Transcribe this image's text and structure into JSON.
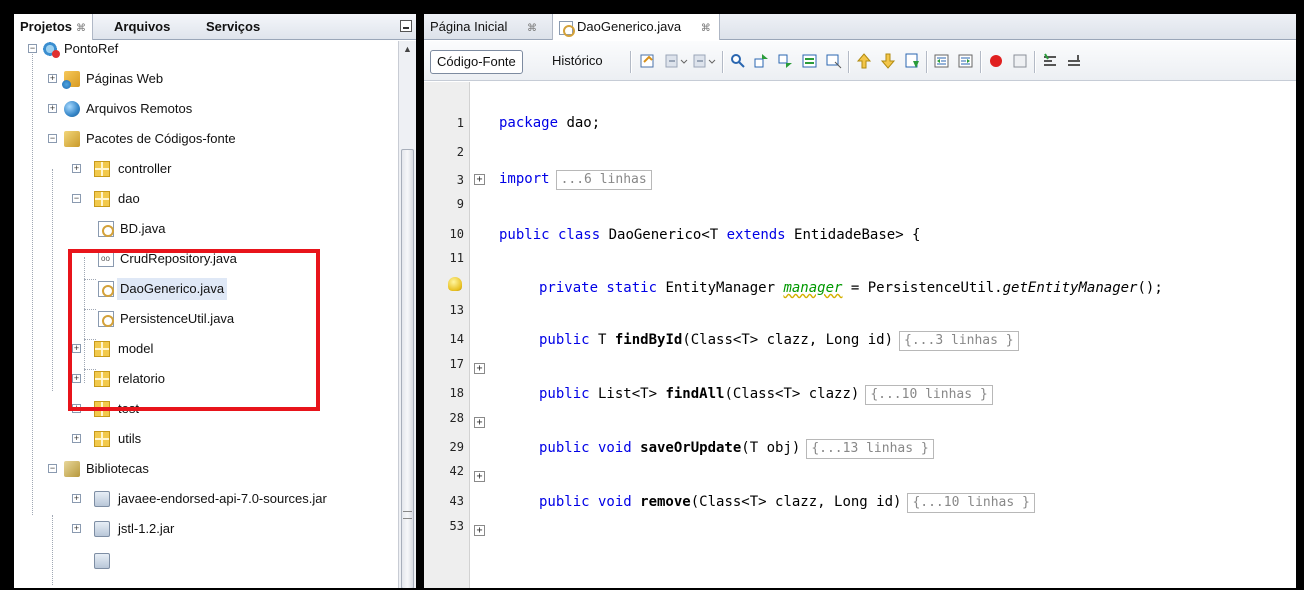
{
  "left_panel": {
    "tabs": [
      {
        "label": "Projetos",
        "close": "⌘",
        "active": true
      },
      {
        "label": "Arquivos",
        "active": false
      },
      {
        "label": "Serviços",
        "active": false
      }
    ],
    "tree": {
      "project": "PontoRef",
      "paginas_web": "Páginas Web",
      "arquivos_remotos": "Arquivos Remotos",
      "pacotes": "Pacotes de Códigos-fonte",
      "controller": "controller",
      "dao": "dao",
      "dao_files": [
        "BD.java",
        "CrudRepository.java",
        "DaoGenerico.java",
        "PersistenceUtil.java"
      ],
      "model": "model",
      "relatorio": "relatorio",
      "test": "test",
      "utils": "utils",
      "bibliotecas": "Bibliotecas",
      "libs": [
        "javaee-endorsed-api-7.0-sources.jar",
        "jstl-1.2.jar"
      ]
    },
    "highlight_color": "#e8141b"
  },
  "editor": {
    "tabs": [
      {
        "label": "Página Inicial",
        "close": "⌘",
        "active": false
      },
      {
        "label": "DaoGenerico.java",
        "close": "⌘",
        "active": true
      }
    ],
    "toolbar": {
      "source_label": "Código-Fonte",
      "history_label": "Histórico"
    },
    "line_numbers": [
      "1",
      "2",
      "3",
      "9",
      "10",
      "11",
      "",
      "13",
      "14",
      "17",
      "18",
      "28",
      "29",
      "42",
      "43",
      "53"
    ],
    "code": {
      "l1_kw": "package",
      "l1_rest": " dao;",
      "l3_kw": "import",
      "l3_fold": "...6 linhas",
      "l10_kw": "public class",
      "l10_name": " DaoGenerico",
      "l10_mid": "<T ",
      "l10_kw2": "extends",
      "l10_rest": " EntidadeBase> {",
      "l12_kw": "private static",
      "l12_type": " EntityManager ",
      "l12_field": "manager",
      "l12_mid": " = PersistenceUtil.",
      "l12_call": "getEntityManager",
      "l12_end": "();",
      "l14_kw": "public",
      "l14_type": " T ",
      "l14_name": "findById",
      "l14_args": "(Class<T> clazz, Long id)",
      "l14_fold": "{...3 linhas }",
      "l18_kw": "public",
      "l18_type": " List<T> ",
      "l18_name": "findAll",
      "l18_args": "(Class<T> clazz)",
      "l18_fold": "{...10 linhas }",
      "l29_kw": "public void",
      "l29_name": " saveOrUpdate",
      "l29_args": "(T obj)",
      "l29_fold": "{...13 linhas }",
      "l43_kw": "public void",
      "l43_name": " remove",
      "l43_args": "(Class<T> clazz, Long id)",
      "l43_fold": "{...10 linhas }"
    }
  }
}
